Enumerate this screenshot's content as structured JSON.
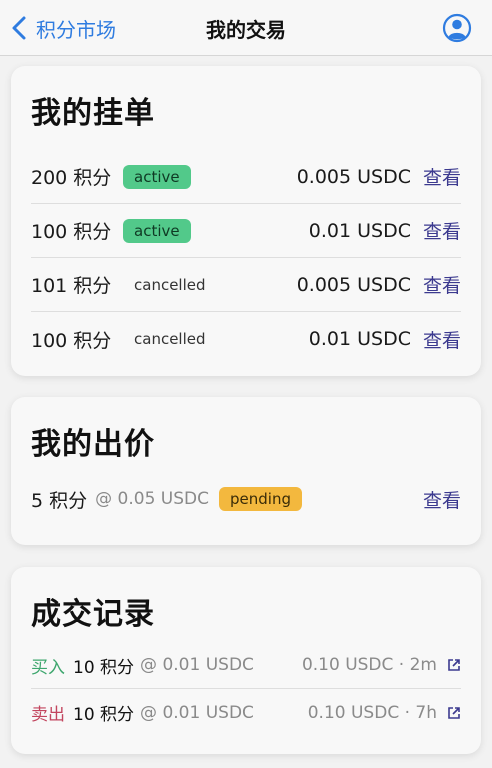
{
  "nav": {
    "back_label": "积分市场",
    "title": "我的交易"
  },
  "listings": {
    "title": "我的挂单",
    "rows": [
      {
        "amount": "200 积分",
        "status": "active",
        "price": "0.005 USDC",
        "view": "查看"
      },
      {
        "amount": "100 积分",
        "status": "active",
        "price": "0.01 USDC",
        "view": "查看"
      },
      {
        "amount": "101 积分",
        "status": "cancelled",
        "price": "0.005 USDC",
        "view": "查看"
      },
      {
        "amount": "100 积分",
        "status": "cancelled",
        "price": "0.01 USDC",
        "view": "查看"
      }
    ]
  },
  "bids": {
    "title": "我的出价",
    "rows": [
      {
        "amount": "5 积分",
        "unit_price": "@ 0.05 USDC",
        "status": "pending",
        "view": "查看"
      }
    ]
  },
  "trades": {
    "title": "成交记录",
    "rows": [
      {
        "side": "买入",
        "amount": "10 积分",
        "unit_price": "@ 0.01 USDC",
        "total": "0.10 USDC",
        "time": "2m"
      },
      {
        "side": "卖出",
        "amount": "10 积分",
        "unit_price": "@ 0.01 USDC",
        "total": "0.10 USDC",
        "time": "7h"
      }
    ]
  },
  "colors": {
    "accent": "#2f7ce0",
    "active": "#52c98a",
    "pending": "#f3b83e",
    "buy": "#3da66d",
    "sell": "#c2455e",
    "link": "#3c3a8f"
  }
}
